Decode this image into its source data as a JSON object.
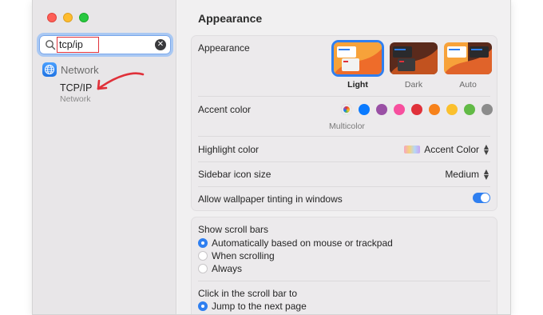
{
  "search": {
    "query": "tcp/ip"
  },
  "results": {
    "section_label": "Network",
    "item": {
      "title": "TCP/IP",
      "subtitle": "Network"
    }
  },
  "main": {
    "title": "Appearance",
    "appearance": {
      "label": "Appearance",
      "options": [
        {
          "label": "Light",
          "selected": true
        },
        {
          "label": "Dark",
          "selected": false
        },
        {
          "label": "Auto",
          "selected": false
        }
      ]
    },
    "accent": {
      "label": "Accent color",
      "colors": [
        "multicolor",
        "#0a7aff",
        "#9a50a5",
        "#f74f9e",
        "#e02e39",
        "#f7821b",
        "#fbc02d",
        "#62ba46",
        "#8c8c8c"
      ],
      "selected_label": "Multicolor"
    },
    "highlight": {
      "label": "Highlight color",
      "value": "Accent Color"
    },
    "sidebar_icon": {
      "label": "Sidebar icon size",
      "value": "Medium"
    },
    "wallpaper_tinting": {
      "label": "Allow wallpaper tinting in windows",
      "enabled": true
    },
    "scroll_bars": {
      "label": "Show scroll bars",
      "options": [
        {
          "label": "Automatically based on mouse or trackpad",
          "selected": true
        },
        {
          "label": "When scrolling",
          "selected": false
        },
        {
          "label": "Always",
          "selected": false
        }
      ]
    },
    "click_scroll": {
      "label": "Click in the scroll bar to",
      "options": [
        {
          "label": "Jump to the next page",
          "selected": true
        }
      ]
    }
  },
  "colors": {
    "accent": "#2f7ff0",
    "annotation": "#e0313a"
  }
}
